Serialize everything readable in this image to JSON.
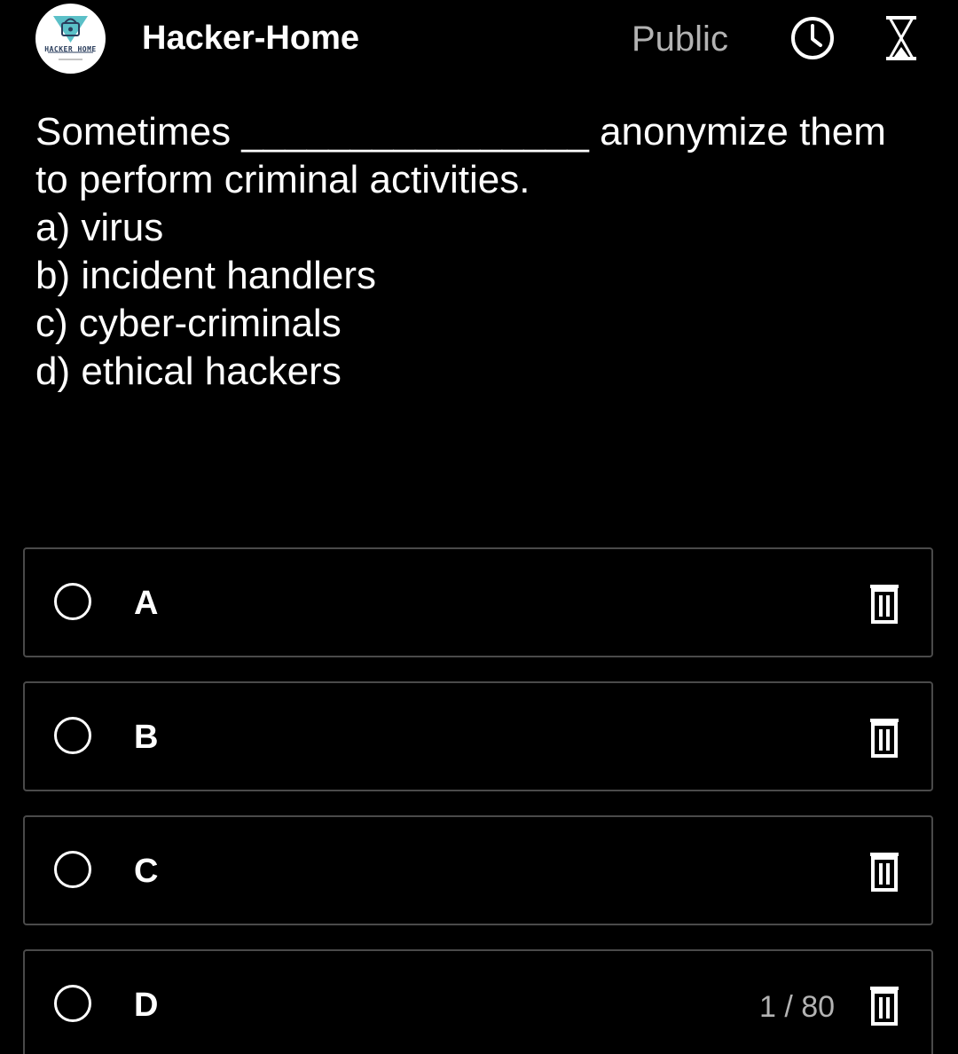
{
  "header": {
    "channel_name": "Hacker-Home",
    "avatar_text": "HACKER HOME",
    "visibility": "Public",
    "icons": [
      "clock-icon",
      "hourglass-icon"
    ]
  },
  "question": {
    "line1_start": "Sometimes",
    "line1_blank": "________________",
    "line1_end": "anonymize them",
    "line2": "to perform criminal activities.",
    "option_a": "a) virus",
    "option_b": "b) incident handlers",
    "option_c": "c) cyber-criminals",
    "option_d": "d) ethical hackers"
  },
  "poll_options": [
    {
      "label": "A"
    },
    {
      "label": "B"
    },
    {
      "label": "C"
    },
    {
      "label": "D"
    }
  ],
  "counter": "1 / 80",
  "colors": {
    "background": "#000000",
    "text": "#ffffff",
    "muted": "#b3b3b3",
    "border": "#4a4a4a"
  }
}
